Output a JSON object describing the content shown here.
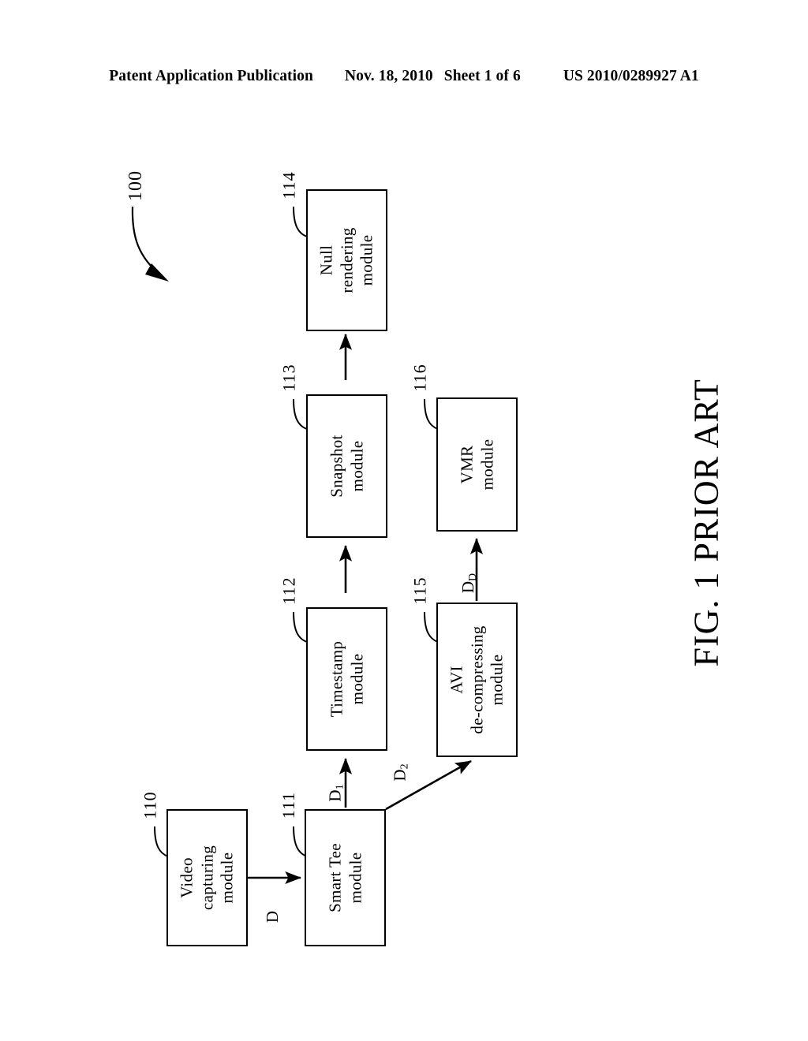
{
  "header": {
    "left": "Patent Application Publication",
    "date": "Nov. 18, 2010",
    "sheet": "Sheet 1 of 6",
    "pub_number": "US 2010/0289927 A1"
  },
  "figure": {
    "caption": "FIG. 1 PRIOR ART",
    "system_ref": "100",
    "nodes": [
      {
        "id": "null-rendering",
        "ref": "114",
        "label": "Null\nrendering\nmodule"
      },
      {
        "id": "snapshot",
        "ref": "113",
        "label": "Snapshot\nmodule"
      },
      {
        "id": "timestamp",
        "ref": "112",
        "label": "Timestamp\nmodule"
      },
      {
        "id": "smart-tee",
        "ref": "111",
        "label": "Smart Tee\nmodule"
      },
      {
        "id": "video-capturing",
        "ref": "110",
        "label": "Video\ncapturing\nmodule"
      },
      {
        "id": "vmr",
        "ref": "116",
        "label": "VMR\nmodule"
      },
      {
        "id": "avi-decompress",
        "ref": "115",
        "label": "AVI\nde-compressing\nmodule"
      }
    ],
    "signals": [
      {
        "id": "d",
        "label": "D",
        "sub": ""
      },
      {
        "id": "d1",
        "label": "D",
        "sub": "1"
      },
      {
        "id": "d2",
        "label": "D",
        "sub": "2"
      },
      {
        "id": "dd",
        "label": "D",
        "sub": "D"
      }
    ]
  },
  "colors": {
    "ink": "#000000",
    "paper": "#ffffff"
  }
}
